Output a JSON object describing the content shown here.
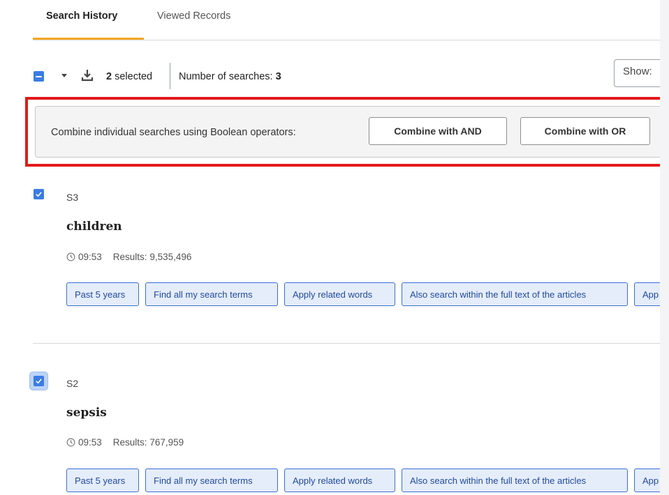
{
  "tabs": [
    {
      "label": "Search History",
      "active": true
    },
    {
      "label": "Viewed Records",
      "active": false
    }
  ],
  "toolbar": {
    "selected_count": "2",
    "selected_suffix": " selected",
    "num_searches_label": "Number of searches: ",
    "num_searches_value": "3",
    "show_label": "Show:"
  },
  "combine": {
    "label": "Combine individual searches using Boolean operators:",
    "and_button": "Combine with AND",
    "or_button": "Combine with OR"
  },
  "entries": [
    {
      "id": "S3",
      "term": "children",
      "time": "09:53",
      "results": "Results: 9,535,496",
      "checked": true,
      "chips": [
        "Past 5 years",
        "Find all my search terms",
        "Apply related words",
        "Also search within the full text of the articles",
        "App"
      ]
    },
    {
      "id": "S2",
      "term": "sepsis",
      "time": "09:53",
      "results": "Results: 767,959",
      "checked": true,
      "chips": [
        "Past 5 years",
        "Find all my search terms",
        "Apply related words",
        "Also search within the full text of the articles",
        "App"
      ]
    }
  ],
  "colors": {
    "accent_tab": "#f5a623",
    "checkbox": "#3b7be4",
    "highlight_frame": "#e3191c",
    "chip_border": "#3c6ed3",
    "chip_bg": "#e5edfb"
  },
  "icons": [
    "chevron-down-icon",
    "download-icon",
    "clock-icon",
    "checkmark-icon"
  ]
}
